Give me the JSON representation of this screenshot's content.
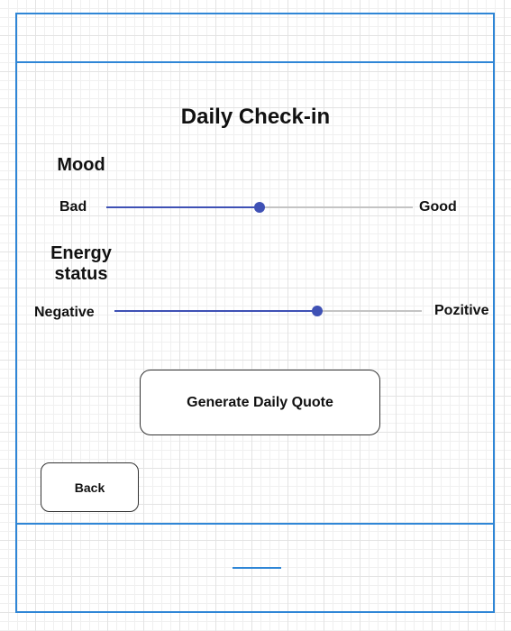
{
  "screen": {
    "title": "Daily Check-in"
  },
  "mood": {
    "label": "Mood",
    "min_label": "Bad",
    "max_label": "Good",
    "value_fraction": 0.5
  },
  "energy": {
    "label": "Energy\nstatus",
    "min_label": "Negative",
    "max_label": "Pozitive",
    "value_fraction": 0.66
  },
  "actions": {
    "generate_label": "Generate Daily Quote",
    "back_label": "Back"
  },
  "colors": {
    "frame_border": "#2f86d6",
    "slider_accent": "#3f51b5",
    "slider_track": "#c4c4c4"
  }
}
